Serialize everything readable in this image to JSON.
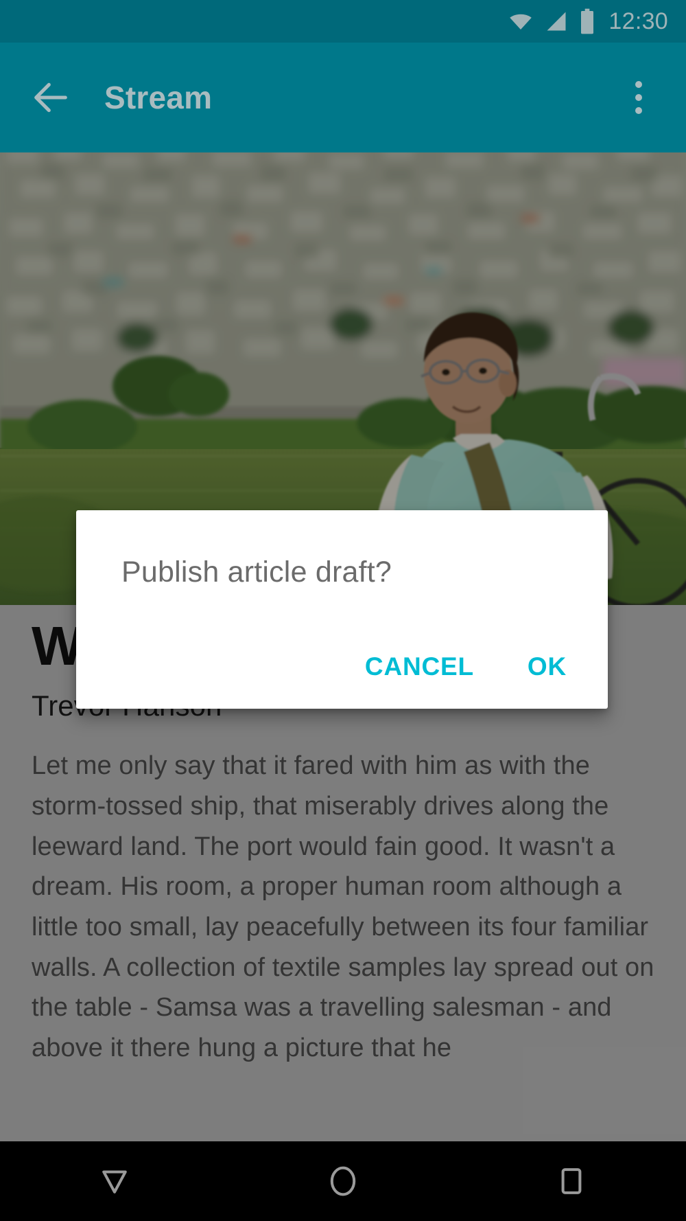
{
  "status_bar": {
    "time": "12:30",
    "icons": [
      "wifi-icon",
      "cellular-signal-icon",
      "battery-icon"
    ],
    "background_color": "#00697a",
    "foreground_color": "#9fb3b7"
  },
  "app_bar": {
    "title": "Stream",
    "back_icon": "arrow-back-icon",
    "overflow_icon": "overflow-menu-icon",
    "background_color": "#00788a",
    "foreground_color": "#a9bcc0"
  },
  "hero": {
    "alt": "Man with glasses in mint green shirt standing with a bicycle in a green meadow, hillside town in the background",
    "scrim": "dimmed"
  },
  "article": {
    "title": "W",
    "author": "Trevor Hanson",
    "body": "Let me only say that it fared with him as with the storm-tossed ship, that miserably drives along the leeward land. The port would fain good. It wasn't a dream. His room, a proper human room although a little too small, lay peacefully between its four familiar walls. A collection of textile samples lay spread out on the table - Samsa was a travelling salesman - and above it there hung a picture that he"
  },
  "dialog": {
    "title": "Publish article draft?",
    "cancel_label": "CANCEL",
    "ok_label": "OK",
    "accent_color": "#00bcd4",
    "background_color": "#ffffff"
  },
  "nav_bar": {
    "back_icon": "nav-back-triangle-icon",
    "home_icon": "nav-home-circle-icon",
    "recents_icon": "nav-recents-square-icon",
    "background_color": "#000000",
    "foreground_color": "#9a9a9a"
  }
}
